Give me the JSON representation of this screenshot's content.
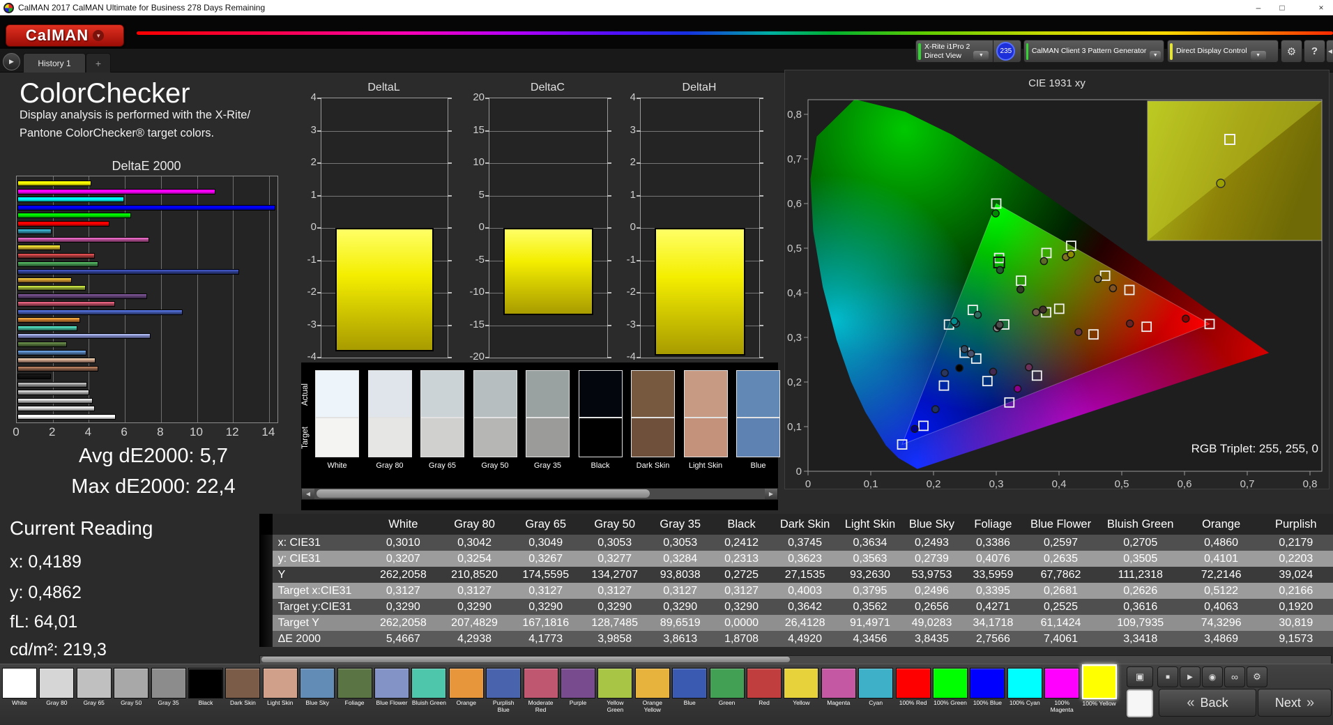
{
  "title_bar": {
    "title": "CalMAN 2017 CalMAN Ultimate for Business 278 Days Remaining",
    "minimize": "–",
    "maximize": "□",
    "close": "×"
  },
  "logo": {
    "text": "CalMAN",
    "caret": "▼"
  },
  "tabs": {
    "scroll": "▶",
    "history": "History 1",
    "add": "+"
  },
  "devices": [
    {
      "line1": "X-Rite i1Pro 2",
      "line2": "Direct View",
      "stripe": "#35d435",
      "badge": "235"
    },
    {
      "line1": "CalMAN Client 3 Pattern Generator",
      "line2": "",
      "stripe": "#35d435"
    },
    {
      "line1": "Direct Display Control",
      "line2": "",
      "stripe": "#e4e43a"
    }
  ],
  "header_buttons": {
    "settings": "⚙",
    "help": "?",
    "collapse": "◀"
  },
  "left_panel": {
    "title": "ColorChecker",
    "desc1": "Display analysis is performed with the X-Rite/",
    "desc2": "Pantone ColorChecker® target colors.",
    "avg": "Avg dE2000: 5,7",
    "max": "Max dE2000: 22,4",
    "current_reading": {
      "title": "Current Reading",
      "x": "x: 0,4189",
      "y": "y: 0,4862",
      "fl": "fL: 64,01",
      "cdm2": "cd/m²: 219,3"
    }
  },
  "chart_data": [
    {
      "id": "deltae2000",
      "type": "bar",
      "orientation": "horizontal",
      "title": "DeltaE 2000",
      "xlim": [
        0,
        14.4
      ],
      "xticks": [
        0,
        2,
        4,
        6,
        8,
        10,
        12,
        14
      ],
      "grid": true,
      "categories": [
        "100% Yellow",
        "100% Magenta",
        "100% Cyan",
        "100% Blue",
        "100% Green",
        "100% Red",
        "Cyan",
        "Magenta",
        "Yellow",
        "Red",
        "Green",
        "Blue",
        "Orange Yellow",
        "Yellow Green",
        "Purple",
        "Moderate Red",
        "Purplish Blue",
        "Orange",
        "Bluish Green",
        "Blue Flower",
        "Foliage",
        "Blue Sky",
        "Light Skin",
        "Dark Skin",
        "Black",
        "Gray 35",
        "Gray 50",
        "Gray 65",
        "Gray 80",
        "White"
      ],
      "values": [
        4.1,
        11.0,
        5.9,
        22.4,
        6.3,
        5.1,
        1.9,
        7.3,
        2.4,
        4.3,
        4.5,
        12.3,
        3.0,
        3.8,
        7.2,
        5.4,
        9.1573,
        3.4869,
        3.3418,
        7.4061,
        2.7566,
        3.8435,
        4.3456,
        4.492,
        1.8708,
        3.8613,
        3.9858,
        4.1773,
        4.2938,
        5.4667
      ],
      "colors": [
        "#ffff00",
        "#ff00ff",
        "#00ffff",
        "#0000ff",
        "#00ee00",
        "#ff0000",
        "#2e8ca3",
        "#b44f93",
        "#cfb32a",
        "#a83a3c",
        "#3f8a4a",
        "#2f3f8f",
        "#c9932f",
        "#93a832",
        "#5d3f70",
        "#b04a60",
        "#4056a8",
        "#c97b2f",
        "#3fae93",
        "#8089c4",
        "#4f6b38",
        "#4f77a8",
        "#c49a82",
        "#8a5f48",
        "#111111",
        "#8f8f8f",
        "#a8a8a8",
        "#bfbfbf",
        "#d4d4d4",
        "#ffffff"
      ]
    },
    {
      "id": "deltaL",
      "type": "bar",
      "title": "DeltaL",
      "ylim": [
        -4,
        4
      ],
      "yticks": [
        4,
        3,
        2,
        1,
        0,
        -1,
        -2,
        -3,
        -4
      ],
      "value": -3.8,
      "color": "#f4ee00"
    },
    {
      "id": "deltaC",
      "type": "bar",
      "title": "DeltaC",
      "ylim": [
        -20,
        20
      ],
      "yticks": [
        20,
        15,
        10,
        5,
        0,
        -5,
        -10,
        -15,
        -20
      ],
      "value": -13.4,
      "color": "#f4ee00"
    },
    {
      "id": "deltaH",
      "type": "bar",
      "title": "DeltaH",
      "ylim": [
        -4,
        4
      ],
      "yticks": [
        4,
        3,
        2,
        1,
        0,
        -1,
        -2,
        -3,
        -4
      ],
      "value": -4.2,
      "clipped": true,
      "color": "#f4ee00"
    },
    {
      "id": "cie1931",
      "type": "scatter",
      "title": "CIE 1931 xy",
      "xlim": [
        0,
        0.82
      ],
      "ylim": [
        0,
        0.83
      ],
      "xtick_labels": [
        "0",
        "0,1",
        "0,2",
        "0,3",
        "0,4",
        "0,5",
        "0,6",
        "0,7",
        "0,8"
      ],
      "ytick_labels": [
        "0,8",
        "0,7",
        "0,6",
        "0,5",
        "0,4",
        "0,3",
        "0,2",
        "0,1",
        "0"
      ],
      "annotation": "RGB Triplet: 255, 255, 0",
      "gamut_triangle": [
        [
          0.64,
          0.33
        ],
        [
          0.3,
          0.6
        ],
        [
          0.15,
          0.06
        ]
      ],
      "targets": [
        [
          0.3127,
          0.329
        ],
        [
          0.4003,
          0.3642
        ],
        [
          0.3795,
          0.3562
        ],
        [
          0.2496,
          0.2656
        ],
        [
          0.3395,
          0.4271
        ],
        [
          0.2681,
          0.2525
        ],
        [
          0.2626,
          0.3616
        ],
        [
          0.5122,
          0.4063
        ],
        [
          0.2166,
          0.192
        ],
        [
          0.4549,
          0.3067
        ],
        [
          0.2859,
          0.2021
        ],
        [
          0.38,
          0.4892
        ],
        [
          0.4735,
          0.4383
        ],
        [
          0.1839,
          0.1018
        ],
        [
          0.3046,
          0.478
        ],
        [
          0.5396,
          0.3239
        ],
        [
          0.4193,
          0.5053
        ],
        [
          0.3648,
          0.2144
        ],
        [
          0.2246,
          0.3287
        ],
        [
          0.64,
          0.33
        ],
        [
          0.3,
          0.6
        ],
        [
          0.15,
          0.06
        ],
        [
          0.3209,
          0.1542
        ]
      ],
      "highlight_square": [
        0.3046,
        0.468
      ],
      "measurements": [
        [
          0.301,
          0.3207
        ],
        [
          0.3042,
          0.3254
        ],
        [
          0.3049,
          0.3267
        ],
        [
          0.3053,
          0.3277
        ],
        [
          0.3053,
          0.3284
        ],
        [
          0.2412,
          0.2313
        ],
        [
          0.3745,
          0.3623
        ],
        [
          0.3634,
          0.3563
        ],
        [
          0.2493,
          0.2739
        ],
        [
          0.3386,
          0.4076
        ],
        [
          0.2597,
          0.2635
        ],
        [
          0.2705,
          0.3505
        ],
        [
          0.486,
          0.4101
        ],
        [
          0.2179,
          0.2203
        ],
        [
          0.431,
          0.312
        ],
        [
          0.295,
          0.223
        ],
        [
          0.376,
          0.471
        ],
        [
          0.462,
          0.431
        ],
        [
          0.203,
          0.139
        ],
        [
          0.306,
          0.451
        ],
        [
          0.513,
          0.331
        ],
        [
          0.411,
          0.48
        ],
        [
          0.352,
          0.233
        ],
        [
          0.236,
          0.331
        ],
        [
          0.602,
          0.342
        ],
        [
          0.299,
          0.578
        ],
        [
          0.17,
          0.095
        ],
        [
          0.233,
          0.336
        ],
        [
          0.334,
          0.185
        ],
        [
          0.4189,
          0.4862
        ]
      ]
    }
  ],
  "swatch_strip": {
    "row_labels": [
      "Actual",
      "Target"
    ],
    "columns": [
      {
        "name": "White",
        "actual": "#edf4fa",
        "target": "#f4f4f2"
      },
      {
        "name": "Gray 80",
        "actual": "#dfe5ea",
        "target": "#e6e6e4"
      },
      {
        "name": "Gray 65",
        "actual": "#ccd3d6",
        "target": "#d0d0ce"
      },
      {
        "name": "Gray 50",
        "actual": "#b7bec0",
        "target": "#b6b6b4"
      },
      {
        "name": "Gray 35",
        "actual": "#99a2a0",
        "target": "#9b9b99"
      },
      {
        "name": "Black",
        "actual": "#04060d",
        "target": "#000000"
      },
      {
        "name": "Dark Skin",
        "actual": "#76593f",
        "target": "#6f503b"
      },
      {
        "name": "Light Skin",
        "actual": "#c69a83",
        "target": "#c4917a"
      },
      {
        "name": "Blue",
        "actual": "#6289b5",
        "target": "#5e83b3"
      }
    ]
  },
  "table": {
    "columns": [
      "White",
      "Gray 80",
      "Gray 65",
      "Gray 50",
      "Gray 35",
      "Black",
      "Dark Skin",
      "Light Skin",
      "Blue Sky",
      "Foliage",
      "Blue Flower",
      "Bluish Green",
      "Orange",
      "Purplish"
    ],
    "rows": [
      {
        "label": "x: CIE31",
        "values": [
          "0,3010",
          "0,3042",
          "0,3049",
          "0,3053",
          "0,3053",
          "0,2412",
          "0,3745",
          "0,3634",
          "0,2493",
          "0,3386",
          "0,2597",
          "0,2705",
          "0,4860",
          "0,2179"
        ]
      },
      {
        "label": "y: CIE31",
        "values": [
          "0,3207",
          "0,3254",
          "0,3267",
          "0,3277",
          "0,3284",
          "0,2313",
          "0,3623",
          "0,3563",
          "0,2739",
          "0,4076",
          "0,2635",
          "0,3505",
          "0,4101",
          "0,2203"
        ]
      },
      {
        "label": "Y",
        "values": [
          "262,2058",
          "210,8520",
          "174,5595",
          "134,2707",
          "93,8038",
          "0,2725",
          "27,1535",
          "93,2630",
          "53,9753",
          "33,5959",
          "67,7862",
          "111,2318",
          "72,2146",
          "39,024"
        ]
      },
      {
        "label": "Target x:CIE31",
        "values": [
          "0,3127",
          "0,3127",
          "0,3127",
          "0,3127",
          "0,3127",
          "0,3127",
          "0,4003",
          "0,3795",
          "0,2496",
          "0,3395",
          "0,2681",
          "0,2626",
          "0,5122",
          "0,2166"
        ]
      },
      {
        "label": "Target y:CIE31",
        "values": [
          "0,3290",
          "0,3290",
          "0,3290",
          "0,3290",
          "0,3290",
          "0,3290",
          "0,3642",
          "0,3562",
          "0,2656",
          "0,4271",
          "0,2525",
          "0,3616",
          "0,4063",
          "0,1920"
        ]
      },
      {
        "label": "Target Y",
        "values": [
          "262,2058",
          "207,4829",
          "167,1816",
          "128,7485",
          "89,6519",
          "0,0000",
          "26,4128",
          "91,4971",
          "49,0283",
          "34,1718",
          "61,1424",
          "109,7935",
          "74,3296",
          "30,819"
        ]
      },
      {
        "label": "ΔE 2000",
        "values": [
          "5,4667",
          "4,2938",
          "4,1773",
          "3,9858",
          "3,8613",
          "1,8708",
          "4,4920",
          "4,3456",
          "3,8435",
          "2,7566",
          "7,4061",
          "3,3418",
          "3,4869",
          "9,1573"
        ]
      }
    ]
  },
  "patch_toolbar": {
    "selected_index": 29,
    "patches": [
      {
        "label": "White",
        "color": "#ffffff"
      },
      {
        "label": "Gray 80",
        "color": "#d6d6d6"
      },
      {
        "label": "Gray 65",
        "color": "#c0c0c0"
      },
      {
        "label": "Gray 50",
        "color": "#a8a8a8"
      },
      {
        "label": "Gray 35",
        "color": "#8c8c8c"
      },
      {
        "label": "Black",
        "color": "#000000"
      },
      {
        "label": "Dark Skin",
        "color": "#7a5c49"
      },
      {
        "label": "Light Skin",
        "color": "#d1a08a"
      },
      {
        "label": "Blue Sky",
        "color": "#628bb5"
      },
      {
        "label": "Foliage",
        "color": "#5a7444"
      },
      {
        "label": "Blue Flower",
        "color": "#8393c6"
      },
      {
        "label": "Bluish Green",
        "color": "#4ec6ab"
      },
      {
        "label": "Orange",
        "color": "#e8963c"
      },
      {
        "label": "Purplish Blue",
        "color": "#4a63ad"
      },
      {
        "label": "Moderate Red",
        "color": "#c05771"
      },
      {
        "label": "Purple",
        "color": "#784b8f"
      },
      {
        "label": "Yellow Green",
        "color": "#a8c545"
      },
      {
        "label": "Orange Yellow",
        "color": "#e8b33c"
      },
      {
        "label": "Blue",
        "color": "#3a5ab2"
      },
      {
        "label": "Green",
        "color": "#41a053"
      },
      {
        "label": "Red",
        "color": "#c03e3e"
      },
      {
        "label": "Yellow",
        "color": "#e8d23c"
      },
      {
        "label": "Magenta",
        "color": "#c458a2"
      },
      {
        "label": "Cyan",
        "color": "#3eb0c8"
      },
      {
        "label": "100% Red",
        "color": "#ff0000"
      },
      {
        "label": "100% Green",
        "color": "#00ff00"
      },
      {
        "label": "100% Blue",
        "color": "#0000ff"
      },
      {
        "label": "100% Cyan",
        "color": "#00ffff"
      },
      {
        "label": "100% Magenta",
        "color": "#ff00ff"
      },
      {
        "label": "100% Yellow",
        "color": "#ffff00"
      }
    ]
  },
  "transport": {
    "icons": {
      "pattern": "▣",
      "stop": "■",
      "play": "▶",
      "camera": "◉",
      "loop": "∞",
      "settings": "⚙"
    },
    "back": "Back",
    "next": "Next",
    "chev_left": "«",
    "chev_right": "»"
  }
}
